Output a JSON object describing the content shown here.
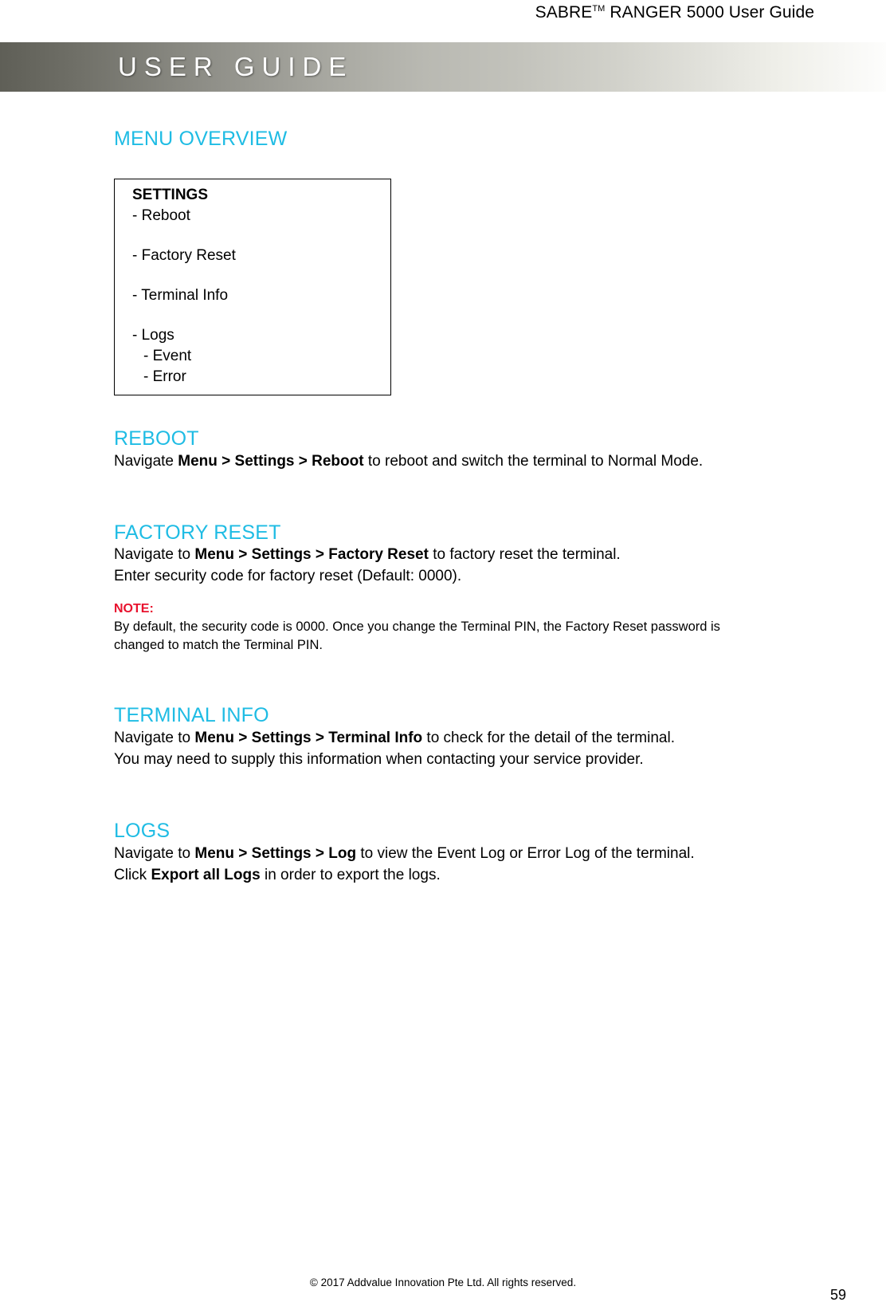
{
  "header": {
    "product": "SABRE",
    "trademark": "TM",
    "title_rest": " RANGER 5000 User Guide",
    "banner_text": "USER GUIDE"
  },
  "sections": {
    "menu_overview": {
      "heading": "MENU OVERVIEW",
      "box": {
        "title": "SETTINGS",
        "items": [
          "- Reboot",
          "- Factory Reset",
          "- Terminal Info",
          "- Logs"
        ],
        "sub_items": [
          "- Event",
          "- Error"
        ]
      }
    },
    "reboot": {
      "heading": "REBOOT",
      "line1_pre": "Navigate ",
      "line1_bold": "Menu > Settings > Reboot",
      "line1_post": " to reboot and switch the terminal to Normal Mode."
    },
    "factory_reset": {
      "heading": "FACTORY RESET",
      "line1_pre": "Navigate to ",
      "line1_bold": "Menu > Settings > Factory Reset",
      "line1_post": " to factory reset the terminal.",
      "line2": "Enter security code for factory reset (Default: 0000).",
      "note_label": "NOTE:",
      "note_line1": "By default, the security code is 0000. Once you change the Terminal PIN, the Factory Reset password is",
      "note_line2": "changed to match the Terminal PIN."
    },
    "terminal_info": {
      "heading": "TERMINAL INFO",
      "line1_pre": "Navigate to ",
      "line1_bold": "Menu > Settings > Terminal Info",
      "line1_post": " to check for the detail of the terminal.",
      "line2": "You may need to supply this information when contacting your service provider."
    },
    "logs": {
      "heading": "LOGS",
      "line1_pre": "Navigate to ",
      "line1_bold": "Menu > Settings > Log",
      "line1_post": " to view the Event Log or Error Log of the terminal.",
      "line2_pre": "Click ",
      "line2_bold": "Export all Logs",
      "line2_post": " in order to export the logs."
    }
  },
  "footer": {
    "copyright": "© 2017 Addvalue Innovation Pte Ltd. All rights reserved.",
    "page_number": "59"
  },
  "colors": {
    "heading_cyan": "#1fbce4",
    "note_red": "#e8112d",
    "banner_dark": "#5f5f57"
  }
}
